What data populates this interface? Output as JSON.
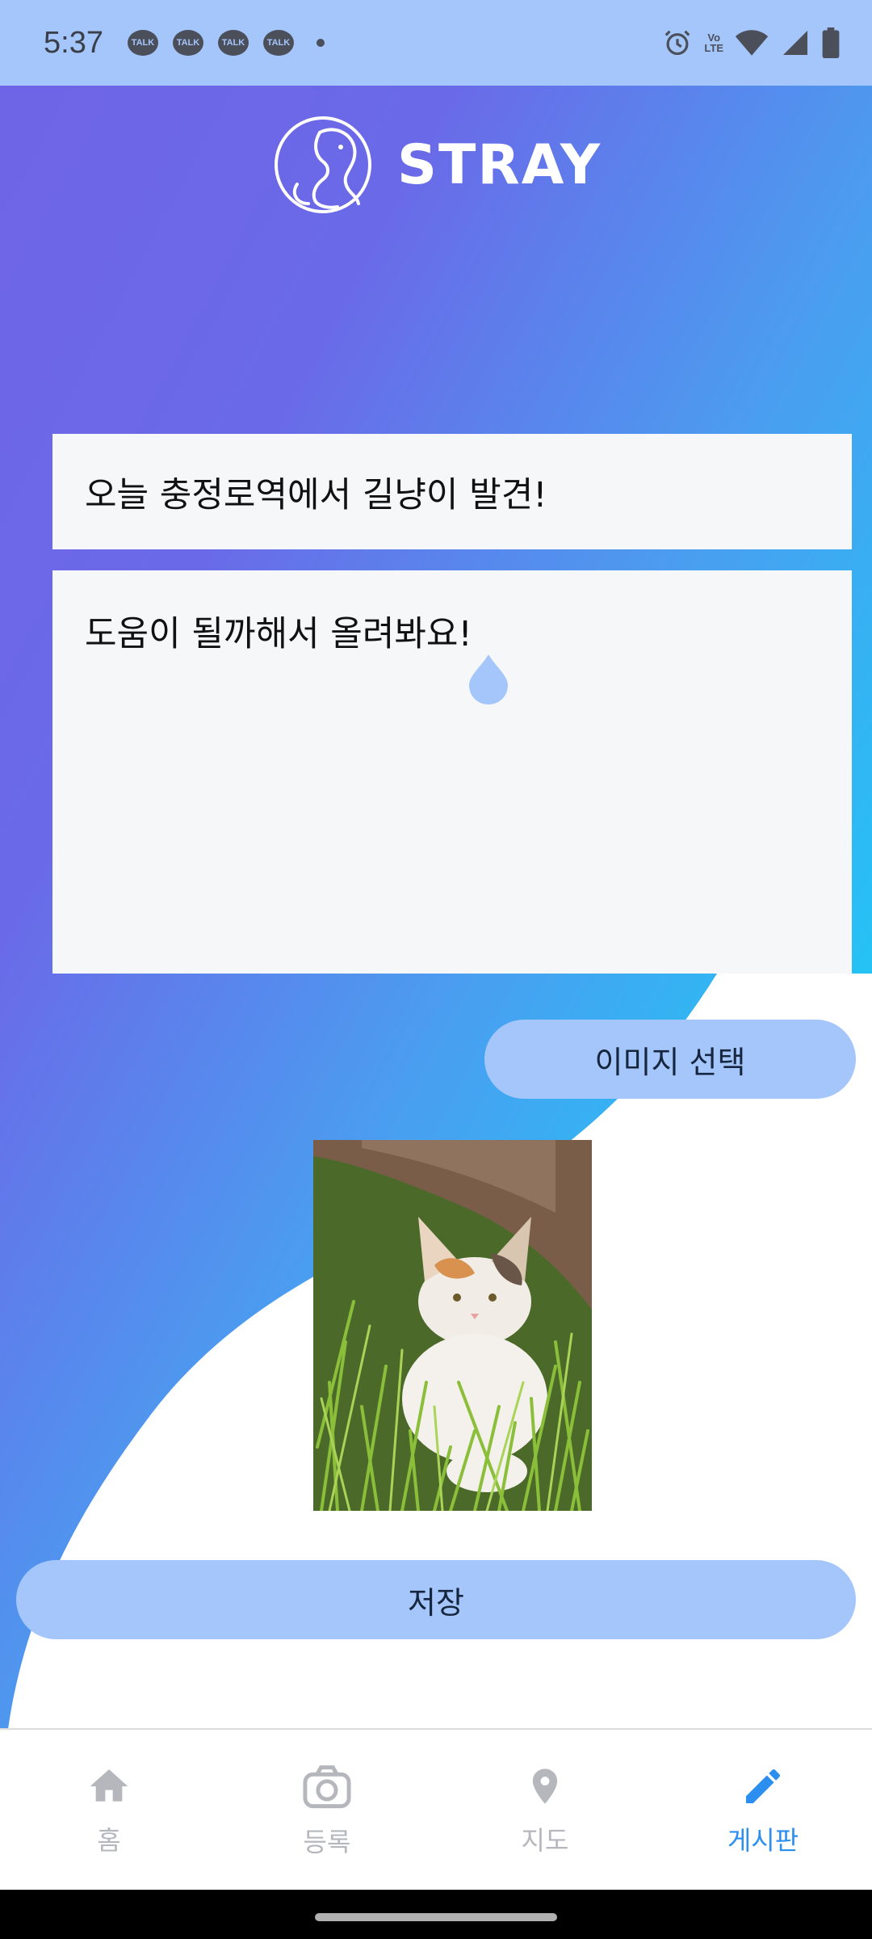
{
  "status_bar": {
    "time": "5:37",
    "notifications": [
      "TALK",
      "TALK",
      "TALK",
      "TALK"
    ],
    "network_badge_top": "Vo",
    "network_badge_bottom": "LTE",
    "icons": [
      "alarm-icon",
      "volte-icon",
      "wifi-icon",
      "signal-icon",
      "battery-icon"
    ]
  },
  "app": {
    "logo_text": "STRAY"
  },
  "post": {
    "title": "오늘 충정로역에서 길냥이 발견!",
    "content": "도움이 될까해서 올려봐요!"
  },
  "buttons": {
    "select_image": "이미지 선택",
    "save": "저장"
  },
  "nav": {
    "items": [
      {
        "label": "홈",
        "icon": "home-icon",
        "active": false
      },
      {
        "label": "등록",
        "icon": "camera-icon",
        "active": false
      },
      {
        "label": "지도",
        "icon": "location-pin-icon",
        "active": false
      },
      {
        "label": "게시판",
        "icon": "pencil-icon",
        "active": true
      }
    ]
  },
  "colors": {
    "status_bar": "#a5c6fb",
    "gradient_start": "#6f64e6",
    "gradient_end": "#1ed6fb",
    "button": "#a4c6fb",
    "nav_active": "#2c8ff0",
    "nav_inactive": "#b5b7bd"
  }
}
